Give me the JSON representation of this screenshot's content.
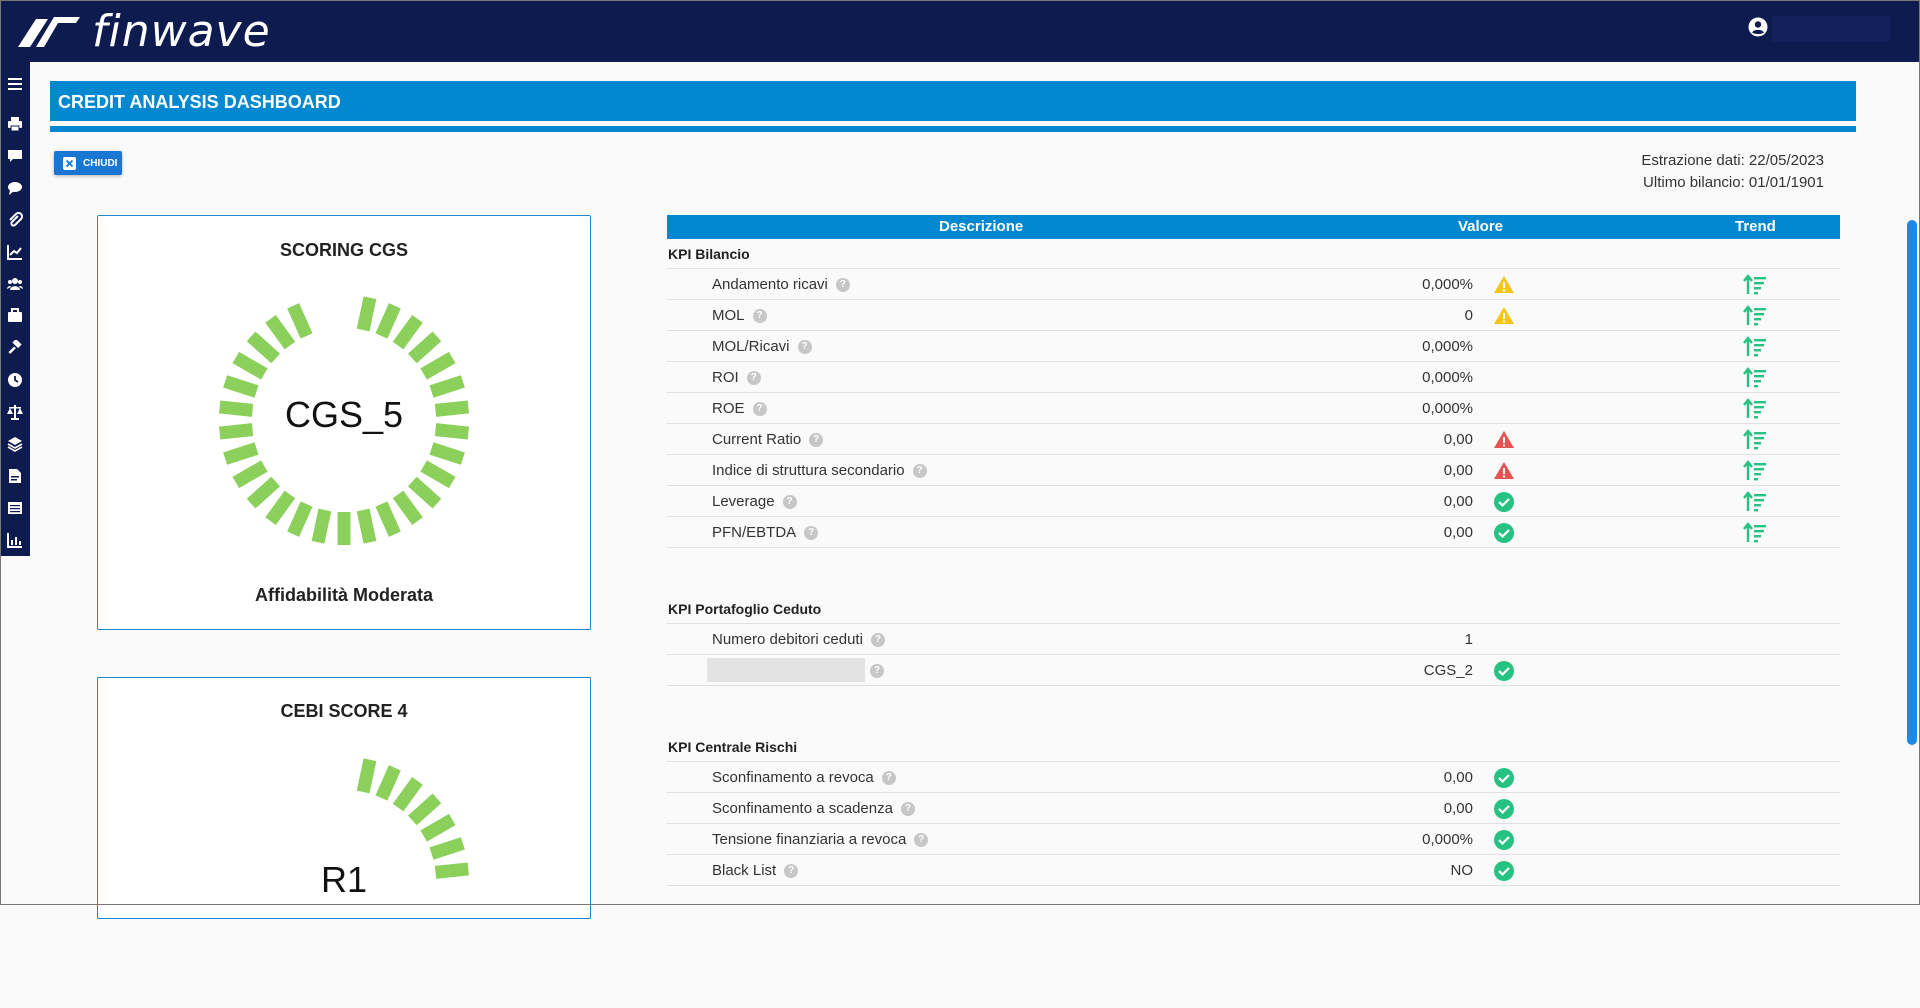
{
  "app": {
    "brand": "finwave"
  },
  "header": {
    "title": "CREDIT ANALYSIS DASHBOARD"
  },
  "toolbar": {
    "close_label": "CHIUDI"
  },
  "meta": {
    "extraction": "Estrazione dati: 22/05/2023",
    "last_balance": "Ultimo bilancio: 01/01/1901"
  },
  "scoring_cgs": {
    "title": "SCORING CGS",
    "value": "CGS_5",
    "footer": "Affidabilità Moderata"
  },
  "cebi": {
    "title": "CEBI SCORE 4",
    "value": "R1"
  },
  "table": {
    "col_desc": "Descrizione",
    "col_value": "Valore",
    "col_trend": "Trend"
  },
  "sections": {
    "bilancio": {
      "title": "KPI Bilancio",
      "rows": [
        {
          "label": "Andamento ricavi",
          "value": "0,000%",
          "status": "warning"
        },
        {
          "label": "MOL",
          "value": "0",
          "status": "warning"
        },
        {
          "label": "MOL/Ricavi",
          "value": "0,000%",
          "status": ""
        },
        {
          "label": "ROI",
          "value": "0,000%",
          "status": ""
        },
        {
          "label": "ROE",
          "value": "0,000%",
          "status": ""
        },
        {
          "label": "Current Ratio",
          "value": "0,00",
          "status": "danger"
        },
        {
          "label": "Indice di struttura secondario",
          "value": "0,00",
          "status": "danger"
        },
        {
          "label": "Leverage",
          "value": "0,00",
          "status": "ok"
        },
        {
          "label": "PFN/EBTDA",
          "value": "0,00",
          "status": "ok"
        }
      ]
    },
    "portafoglio": {
      "title": "KPI Portafoglio Ceduto",
      "rows": [
        {
          "label": "Numero debitori ceduti",
          "value": "1",
          "status": ""
        },
        {
          "label": "",
          "value": "CGS_2",
          "status": "ok"
        }
      ]
    },
    "centrale": {
      "title": "KPI Centrale Rischi",
      "rows": [
        {
          "label": "Sconfinamento a revoca",
          "value": "0,00",
          "status": "ok"
        },
        {
          "label": "Sconfinamento a scadenza",
          "value": "0,00",
          "status": "ok"
        },
        {
          "label": "Tensione finanziaria a revoca",
          "value": "0,000%",
          "status": "ok"
        },
        {
          "label": "Black List",
          "value": "NO",
          "status": "ok"
        }
      ]
    }
  },
  "colors": {
    "navy": "#0d1b4f",
    "accent": "#0288d1",
    "gauge_green": "#8bd05a",
    "ok": "#26c281",
    "warning": "#f5c518",
    "danger": "#e55353",
    "trend": "#26c281"
  },
  "icons": {
    "sidebar": [
      "menu-icon",
      "print-icon",
      "comment-icon",
      "comments-icon",
      "paperclip-icon",
      "chart-line-icon",
      "users-icon",
      "briefcase-icon",
      "gavel-icon",
      "clock-icon",
      "balance-scale-icon",
      "layers-icon",
      "file-pdf-icon",
      "list-icon",
      "bar-chart-icon"
    ]
  }
}
